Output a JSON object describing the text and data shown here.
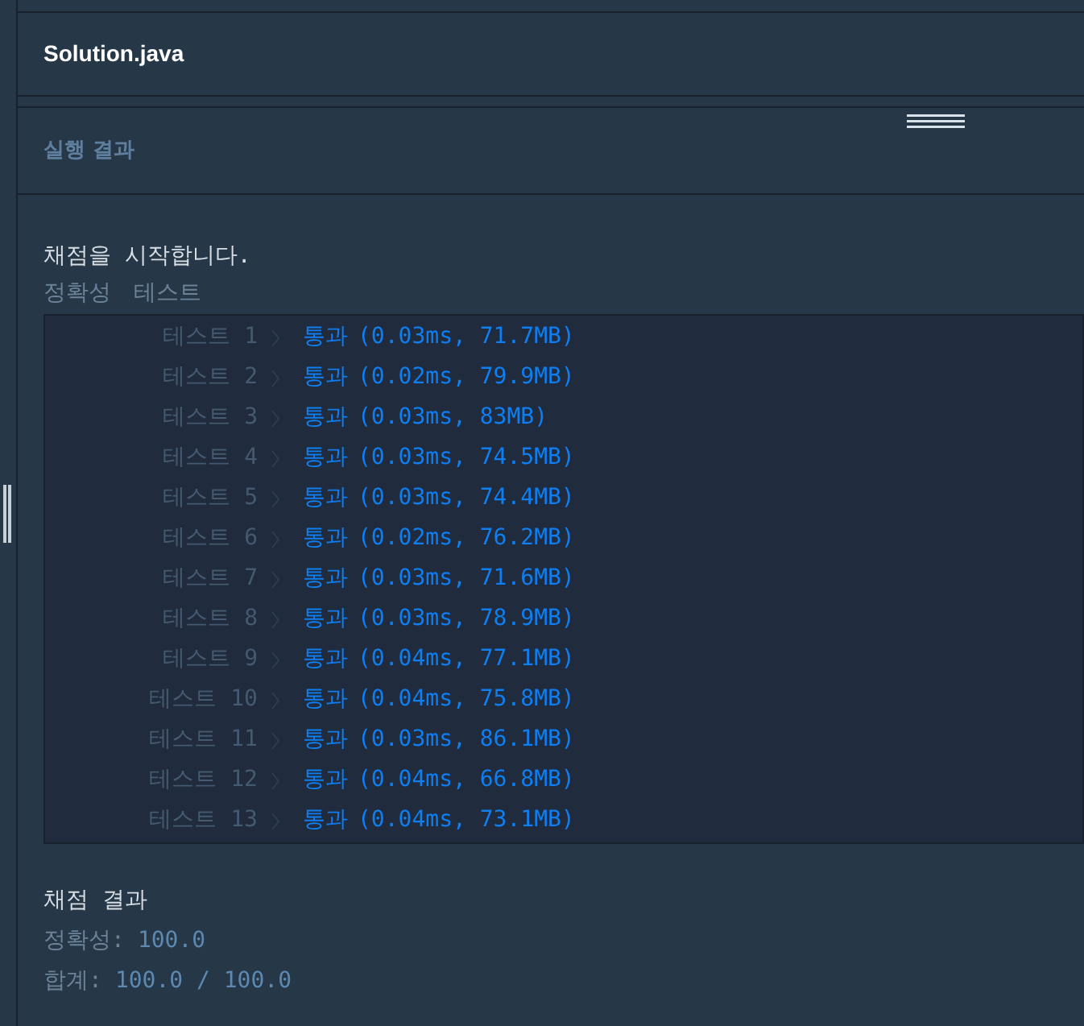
{
  "editor_tab": {
    "title": "Solution.java"
  },
  "output_panel": {
    "title": "실행 결과"
  },
  "grading": {
    "start_message": "채점을 시작합니다.",
    "section_labels": [
      "정확성",
      "테스트"
    ],
    "tests": [
      {
        "name": "테스트 1",
        "status": "통과",
        "detail": "(0.03ms, 71.7MB)"
      },
      {
        "name": "테스트 2",
        "status": "통과",
        "detail": "(0.02ms, 79.9MB)"
      },
      {
        "name": "테스트 3",
        "status": "통과",
        "detail": "(0.03ms, 83MB)"
      },
      {
        "name": "테스트 4",
        "status": "통과",
        "detail": "(0.03ms, 74.5MB)"
      },
      {
        "name": "테스트 5",
        "status": "통과",
        "detail": "(0.03ms, 74.4MB)"
      },
      {
        "name": "테스트 6",
        "status": "통과",
        "detail": "(0.02ms, 76.2MB)"
      },
      {
        "name": "테스트 7",
        "status": "통과",
        "detail": "(0.03ms, 71.6MB)"
      },
      {
        "name": "테스트 8",
        "status": "통과",
        "detail": "(0.03ms, 78.9MB)"
      },
      {
        "name": "테스트 9",
        "status": "통과",
        "detail": "(0.04ms, 77.1MB)"
      },
      {
        "name": "테스트 10",
        "status": "통과",
        "detail": "(0.04ms, 75.8MB)"
      },
      {
        "name": "테스트 11",
        "status": "통과",
        "detail": "(0.03ms, 86.1MB)"
      },
      {
        "name": "테스트 12",
        "status": "통과",
        "detail": "(0.04ms, 66.8MB)"
      },
      {
        "name": "테스트 13",
        "status": "통과",
        "detail": "(0.04ms, 73.1MB)"
      }
    ],
    "result_title": "채점 결과",
    "summary": [
      {
        "label": "정확성:",
        "value": "100.0"
      },
      {
        "label": "합계:",
        "value": "100.0 / 100.0"
      }
    ]
  }
}
